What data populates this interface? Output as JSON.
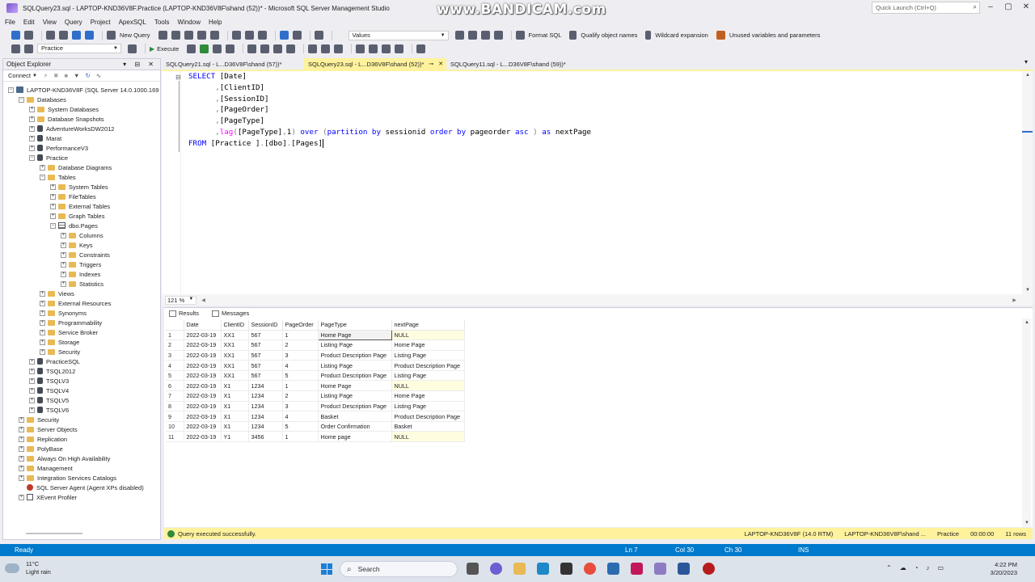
{
  "window": {
    "title": "SQLQuery23.sql - LAPTOP-KND36V8F.Practice (LAPTOP-KND36V8F\\shand (52))* - Microsoft SQL Server Management Studio",
    "watermark": "www.BANDICAM.com",
    "quick_launch_placeholder": "Quick Launch (Ctrl+Q)"
  },
  "menu": [
    "File",
    "Edit",
    "View",
    "Query",
    "Project",
    "ApexSQL",
    "Tools",
    "Window",
    "Help"
  ],
  "toolbar1": {
    "new_query": "New Query",
    "values_select": "Values",
    "format_sql": "Format SQL",
    "qualify": "Qualify object names",
    "wildcard": "Wildcard expansion",
    "unused": "Unused variables and parameters"
  },
  "toolbar2": {
    "database_select": "Practice",
    "execute": "Execute"
  },
  "object_explorer": {
    "title": "Object Explorer",
    "connect": "Connect",
    "server": "LAPTOP-KND36V8F (SQL Server 14.0.1000.169",
    "nodes": [
      {
        "label": "Databases",
        "level": 1,
        "icon": "folder",
        "exp": "-"
      },
      {
        "label": "System Databases",
        "level": 2,
        "icon": "folder",
        "exp": "+"
      },
      {
        "label": "Database Snapshots",
        "level": 2,
        "icon": "folder",
        "exp": "+"
      },
      {
        "label": "AdventureWorksDW2012",
        "level": 2,
        "icon": "db",
        "exp": "+"
      },
      {
        "label": "Marat",
        "level": 2,
        "icon": "db",
        "exp": "+"
      },
      {
        "label": "PerformanceV3",
        "level": 2,
        "icon": "db",
        "exp": "+"
      },
      {
        "label": "Practice",
        "level": 2,
        "icon": "db",
        "exp": "-"
      },
      {
        "label": "Database Diagrams",
        "level": 3,
        "icon": "folder",
        "exp": "+"
      },
      {
        "label": "Tables",
        "level": 3,
        "icon": "folder",
        "exp": "-"
      },
      {
        "label": "System Tables",
        "level": 4,
        "icon": "folder",
        "exp": "+"
      },
      {
        "label": "FileTables",
        "level": 4,
        "icon": "folder",
        "exp": "+"
      },
      {
        "label": "External Tables",
        "level": 4,
        "icon": "folder",
        "exp": "+"
      },
      {
        "label": "Graph Tables",
        "level": 4,
        "icon": "folder",
        "exp": "+"
      },
      {
        "label": "dbo.Pages",
        "level": 4,
        "icon": "table",
        "exp": "-"
      },
      {
        "label": "Columns",
        "level": 5,
        "icon": "folder",
        "exp": "+"
      },
      {
        "label": "Keys",
        "level": 5,
        "icon": "folder",
        "exp": "+"
      },
      {
        "label": "Constraints",
        "level": 5,
        "icon": "folder",
        "exp": "+"
      },
      {
        "label": "Triggers",
        "level": 5,
        "icon": "folder",
        "exp": "+"
      },
      {
        "label": "Indexes",
        "level": 5,
        "icon": "folder",
        "exp": "+"
      },
      {
        "label": "Statistics",
        "level": 5,
        "icon": "folder",
        "exp": "+"
      },
      {
        "label": "Views",
        "level": 3,
        "icon": "folder",
        "exp": "+"
      },
      {
        "label": "External Resources",
        "level": 3,
        "icon": "folder",
        "exp": "+"
      },
      {
        "label": "Synonyms",
        "level": 3,
        "icon": "folder",
        "exp": "+"
      },
      {
        "label": "Programmability",
        "level": 3,
        "icon": "folder",
        "exp": "+"
      },
      {
        "label": "Service Broker",
        "level": 3,
        "icon": "folder",
        "exp": "+"
      },
      {
        "label": "Storage",
        "level": 3,
        "icon": "folder",
        "exp": "+"
      },
      {
        "label": "Security",
        "level": 3,
        "icon": "folder",
        "exp": "+"
      },
      {
        "label": "PracticeSQL",
        "level": 2,
        "icon": "db",
        "exp": "+"
      },
      {
        "label": "TSQL2012",
        "level": 2,
        "icon": "db",
        "exp": "+"
      },
      {
        "label": "TSQLV3",
        "level": 2,
        "icon": "db",
        "exp": "+"
      },
      {
        "label": "TSQLV4",
        "level": 2,
        "icon": "db",
        "exp": "+"
      },
      {
        "label": "TSQLV5",
        "level": 2,
        "icon": "db",
        "exp": "+"
      },
      {
        "label": "TSQLV6",
        "level": 2,
        "icon": "db",
        "exp": "+"
      },
      {
        "label": "Security",
        "level": 1,
        "icon": "folder",
        "exp": "+"
      },
      {
        "label": "Server Objects",
        "level": 1,
        "icon": "folder",
        "exp": "+"
      },
      {
        "label": "Replication",
        "level": 1,
        "icon": "folder",
        "exp": "+"
      },
      {
        "label": "PolyBase",
        "level": 1,
        "icon": "folder",
        "exp": "+"
      },
      {
        "label": "Always On High Availability",
        "level": 1,
        "icon": "folder",
        "exp": "+"
      },
      {
        "label": "Management",
        "level": 1,
        "icon": "folder",
        "exp": "+"
      },
      {
        "label": "Integration Services Catalogs",
        "level": 1,
        "icon": "folder",
        "exp": "+"
      },
      {
        "label": "SQL Server Agent (Agent XPs disabled)",
        "level": 1,
        "icon": "agent",
        "exp": ""
      },
      {
        "label": "XEvent Profiler",
        "level": 1,
        "icon": "xe",
        "exp": "+"
      }
    ]
  },
  "tabs": [
    {
      "label": "SQLQuery21.sql - L...D36V8F\\shand (57))*",
      "active": false
    },
    {
      "label": "SQLQuery23.sql - L...D36V8F\\shand (52))*",
      "active": true
    },
    {
      "label": "SQLQuery11.sql - L...D36V8F\\shand (59))*",
      "active": false
    }
  ],
  "editor": {
    "lines": [
      [
        [
          "kw",
          "SELECT "
        ],
        [
          "id",
          "[Date]"
        ]
      ],
      [
        [
          "gy",
          "      ,"
        ],
        [
          "id",
          "[ClientID]"
        ]
      ],
      [
        [
          "gy",
          "      ,"
        ],
        [
          "id",
          "[SessionID]"
        ]
      ],
      [
        [
          "gy",
          "      ,"
        ],
        [
          "id",
          "[PageOrder]"
        ]
      ],
      [
        [
          "gy",
          "      ,"
        ],
        [
          "id",
          "[PageType]"
        ]
      ],
      [
        [
          "gy",
          "      ,"
        ],
        [
          "fn",
          "lag"
        ],
        [
          "gy",
          "("
        ],
        [
          "id",
          "[PageType]"
        ],
        [
          "gy",
          ","
        ],
        [
          "id",
          "1"
        ],
        [
          "gy",
          ") "
        ],
        [
          "kw",
          "over "
        ],
        [
          "gy",
          "("
        ],
        [
          "kw",
          "partition by "
        ],
        [
          "id",
          "sessionid "
        ],
        [
          "kw",
          "order by "
        ],
        [
          "id",
          "pageorder "
        ],
        [
          "kw",
          "asc "
        ],
        [
          "gy",
          ") "
        ],
        [
          "kw",
          "as "
        ],
        [
          "id",
          "nextPage"
        ]
      ],
      [
        [
          "kw",
          "FROM "
        ],
        [
          "id",
          "[Practice ]"
        ],
        [
          "gy",
          "."
        ],
        [
          "id",
          "[dbo]"
        ],
        [
          "gy",
          "."
        ],
        [
          "id",
          "[Pages]"
        ]
      ]
    ],
    "zoom": "121 %"
  },
  "results": {
    "tab_results": "Results",
    "tab_messages": "Messages",
    "columns": [
      "Date",
      "ClientID",
      "SessionID",
      "PageOrder",
      "PageType",
      "nextPage"
    ],
    "rows": [
      [
        "1",
        "2022-03-19",
        "XX1",
        "567",
        "1",
        "Home Page",
        "NULL"
      ],
      [
        "2",
        "2022-03-19",
        "XX1",
        "567",
        "2",
        "Listing Page",
        "Home Page"
      ],
      [
        "3",
        "2022-03-19",
        "XX1",
        "567",
        "3",
        "Product Description Page",
        "Listing Page"
      ],
      [
        "4",
        "2022-03-19",
        "XX1",
        "567",
        "4",
        "Listing Page",
        "Product Description Page"
      ],
      [
        "5",
        "2022-03-19",
        "XX1",
        "567",
        "5",
        "Product Description Page",
        "Listing Page"
      ],
      [
        "6",
        "2022-03-19",
        "X1",
        "1234",
        "1",
        "Home Page",
        "NULL"
      ],
      [
        "7",
        "2022-03-19",
        "X1",
        "1234",
        "2",
        "Listing Page",
        "Home Page"
      ],
      [
        "8",
        "2022-03-19",
        "X1",
        "1234",
        "3",
        "Product Description Page",
        "Listing Page"
      ],
      [
        "9",
        "2022-03-19",
        "X1",
        "1234",
        "4",
        "Basket",
        "Product Description Page"
      ],
      [
        "10",
        "2022-03-19",
        "X1",
        "1234",
        "5",
        "Order Confirmation",
        "Basket"
      ],
      [
        "11",
        "2022-03-19",
        "Y1",
        "3456",
        "1",
        "Home page",
        "NULL"
      ]
    ]
  },
  "query_status": {
    "message": "Query executed successfully.",
    "server": "LAPTOP-KND36V8F (14.0 RTM)",
    "user": "LAPTOP-KND36V8F\\shand ...",
    "database": "Practice",
    "elapsed": "00:00:00",
    "rows": "11 rows"
  },
  "app_status": {
    "ready": "Ready",
    "ln": "Ln 7",
    "col": "Col 30",
    "ch": "Ch 30",
    "ins": "INS"
  },
  "taskbar": {
    "temp": "11°C",
    "weather": "Light rain",
    "search": "Search",
    "time": "4:22 PM",
    "date": "3/20/2023"
  },
  "colors": {
    "accent": "#007acc",
    "active_tab": "#fff29d",
    "keyword": "#0000ff",
    "function": "#ff00ff"
  }
}
